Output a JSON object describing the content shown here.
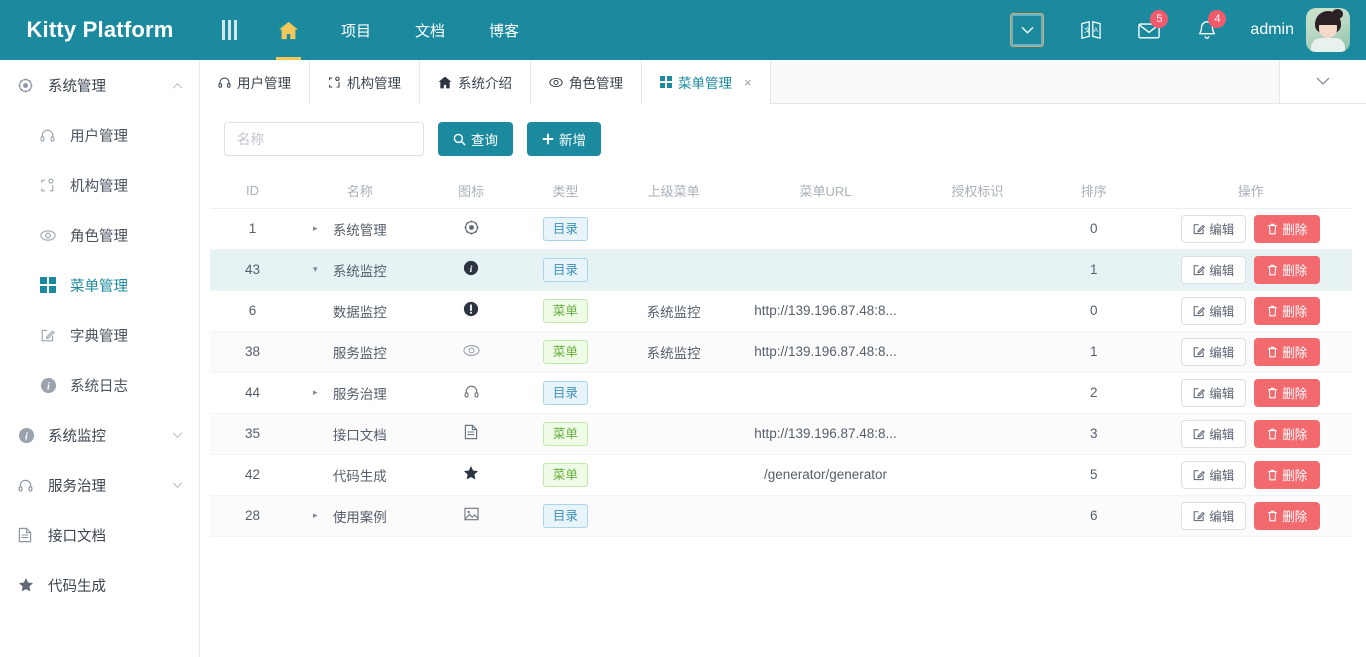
{
  "header": {
    "logo": "Kitty Platform",
    "menu_icon": "hamburger-icon",
    "nav": [
      {
        "label": "",
        "icon": "home-icon",
        "active": true
      },
      {
        "label": "项目",
        "icon": "",
        "active": false
      },
      {
        "label": "文档",
        "icon": "",
        "active": false
      },
      {
        "label": "博客",
        "icon": "",
        "active": false
      }
    ],
    "dropdown_icon": "chevron-down-icon",
    "translate_icon": "translate-icon",
    "message_icon": "envelope-icon",
    "message_count": "5",
    "notification_icon": "bell-icon",
    "notification_count": "4",
    "username": "admin",
    "avatar_alt": "user-avatar"
  },
  "sidebar": {
    "groups": [
      {
        "label": "系统管理",
        "icon": "gear-icon",
        "expanded": true,
        "arrow": "chevron-up-icon",
        "items": [
          {
            "label": "用户管理",
            "icon": "headphones-icon",
            "active": false
          },
          {
            "label": "机构管理",
            "icon": "org-icon",
            "active": false
          },
          {
            "label": "角色管理",
            "icon": "eye-icon",
            "active": false
          },
          {
            "label": "菜单管理",
            "icon": "grid-icon",
            "active": true
          },
          {
            "label": "字典管理",
            "icon": "edit-square-icon",
            "active": false
          },
          {
            "label": "系统日志",
            "icon": "info-circle-icon",
            "active": false
          }
        ]
      },
      {
        "label": "系统监控",
        "icon": "info-circle-icon",
        "expanded": false,
        "arrow": "chevron-down-icon",
        "items": []
      },
      {
        "label": "服务治理",
        "icon": "headphones-icon",
        "expanded": false,
        "arrow": "chevron-down-icon",
        "items": []
      },
      {
        "label": "接口文档",
        "icon": "file-icon",
        "expanded": null,
        "arrow": "",
        "items": []
      },
      {
        "label": "代码生成",
        "icon": "star-icon",
        "expanded": null,
        "arrow": "",
        "items": []
      }
    ]
  },
  "tabs": {
    "items": [
      {
        "label": "用户管理",
        "icon": "headphones-icon",
        "active": false,
        "closable": false
      },
      {
        "label": "机构管理",
        "icon": "org-icon",
        "active": false,
        "closable": false
      },
      {
        "label": "系统介绍",
        "icon": "home-icon",
        "active": false,
        "closable": false
      },
      {
        "label": "角色管理",
        "icon": "eye-icon",
        "active": false,
        "closable": false
      },
      {
        "label": "菜单管理",
        "icon": "grid-icon",
        "active": true,
        "closable": true,
        "close_label": "×"
      }
    ],
    "dropdown_icon": "chevron-down-icon"
  },
  "toolbar": {
    "search_placeholder": "名称",
    "search_value": "",
    "query_label": "查询",
    "query_icon": "search-icon",
    "add_label": "新增",
    "add_icon": "plus-icon"
  },
  "table": {
    "columns": [
      "ID",
      "名称",
      "图标",
      "类型",
      "上级菜单",
      "菜单URL",
      "授权标识",
      "排序",
      "操作"
    ],
    "edit_label": "编辑",
    "edit_icon": "edit-icon",
    "delete_label": "删除",
    "delete_icon": "trash-icon",
    "rows": [
      {
        "id": "1",
        "name": "系统管理",
        "icon": "gear-icon",
        "toggle": "right",
        "type": "目录",
        "type_kind": "dir",
        "parent": "",
        "url": "",
        "perm": "",
        "sort": "0",
        "highlight": false
      },
      {
        "id": "43",
        "name": "系统监控",
        "icon": "info-circle-icon",
        "toggle": "down",
        "type": "目录",
        "type_kind": "dir",
        "parent": "",
        "url": "",
        "perm": "",
        "sort": "1",
        "highlight": true
      },
      {
        "id": "6",
        "name": "数据监控",
        "icon": "exclamation-circle-icon",
        "toggle": "",
        "type": "菜单",
        "type_kind": "menu",
        "parent": "系统监控",
        "url": "http://139.196.87.48:8...",
        "perm": "",
        "sort": "0",
        "highlight": false
      },
      {
        "id": "38",
        "name": "服务监控",
        "icon": "eye-icon",
        "toggle": "",
        "type": "菜单",
        "type_kind": "menu",
        "parent": "系统监控",
        "url": "http://139.196.87.48:8...",
        "perm": "",
        "sort": "1",
        "highlight": false
      },
      {
        "id": "44",
        "name": "服务治理",
        "icon": "headphones-icon",
        "toggle": "right",
        "type": "目录",
        "type_kind": "dir",
        "parent": "",
        "url": "",
        "perm": "",
        "sort": "2",
        "highlight": false
      },
      {
        "id": "35",
        "name": "接口文档",
        "icon": "file-icon",
        "toggle": "",
        "type": "菜单",
        "type_kind": "menu",
        "parent": "",
        "url": "http://139.196.87.48:8...",
        "perm": "",
        "sort": "3",
        "highlight": false
      },
      {
        "id": "42",
        "name": "代码生成",
        "icon": "star-icon",
        "toggle": "",
        "type": "菜单",
        "type_kind": "menu",
        "parent": "",
        "url": "/generator/generator",
        "perm": "",
        "sort": "5",
        "highlight": false
      },
      {
        "id": "28",
        "name": "使用案例",
        "icon": "image-icon",
        "toggle": "right",
        "type": "目录",
        "type_kind": "dir",
        "parent": "",
        "url": "",
        "perm": "",
        "sort": "6",
        "highlight": false
      }
    ]
  },
  "colors": {
    "brand": "#1b8a9e",
    "accent_yellow": "#f2c75c",
    "danger": "#f2696e",
    "badge_red": "#f2596a",
    "row_highlight": "#e6f2f3"
  }
}
